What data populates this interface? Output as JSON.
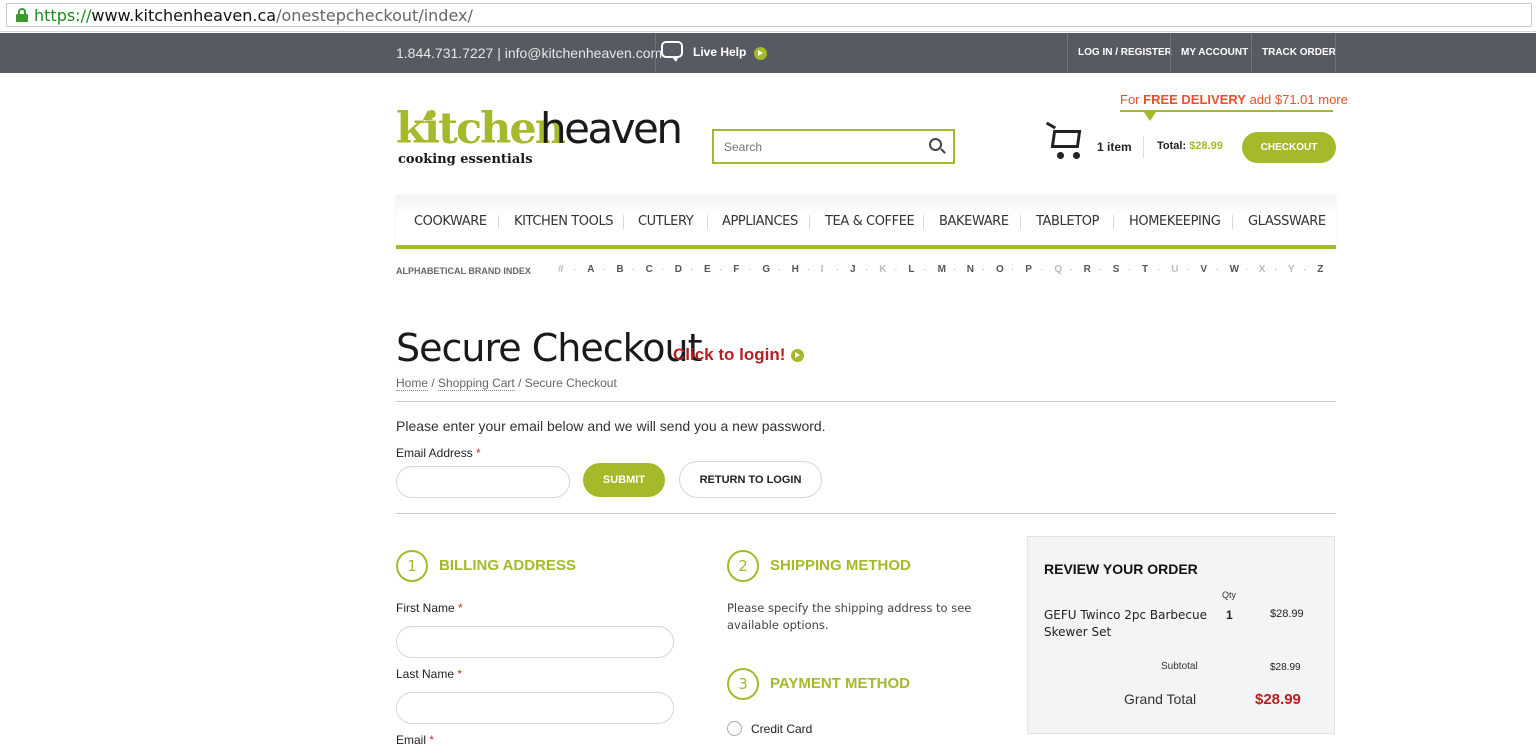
{
  "browser": {
    "url_protocol": "https://",
    "url_host": "www.kitchenheaven.ca",
    "url_path": "/onestepcheckout/index/"
  },
  "topbar": {
    "phone_email": "1.844.731.7227 | info@kitchenheaven.com",
    "live_help": "Live Help",
    "links": [
      "LOG IN / REGISTER",
      "MY ACCOUNT",
      "TRACK ORDER"
    ]
  },
  "header": {
    "logo_kitchen": "kitchen",
    "logo_heaven": "heaven",
    "logo_tagline": "cooking essentials",
    "search_placeholder": "Search",
    "delivery_for": "For ",
    "delivery_free": "FREE DELIVERY",
    "delivery_more": " add $71.01 more",
    "cart_count": "1 item",
    "cart_total_label": "Total: ",
    "cart_total_amount": "$28.99",
    "checkout_label": "CHECKOUT"
  },
  "nav": {
    "items": [
      "COOKWARE",
      "KITCHEN TOOLS",
      "CUTLERY",
      "APPLIANCES",
      "TEA & COFFEE",
      "BAKEWARE",
      "TABLETOP",
      "HOMEKEEPING",
      "GLASSWARE"
    ]
  },
  "brand_index": {
    "label": "ALPHABETICAL BRAND INDEX",
    "letters": [
      "#",
      "A",
      "B",
      "C",
      "D",
      "E",
      "F",
      "G",
      "H",
      "I",
      "J",
      "K",
      "L",
      "M",
      "N",
      "O",
      "P",
      "Q",
      "R",
      "S",
      "T",
      "U",
      "V",
      "W",
      "X",
      "Y",
      "Z"
    ],
    "disabled": [
      "#",
      "I",
      "K",
      "Q",
      "U",
      "X",
      "Y"
    ]
  },
  "page": {
    "title": "Secure Checkout",
    "login_link": "Click to login!",
    "breadcrumb_home": "Home",
    "breadcrumb_cart": "Shopping Cart",
    "breadcrumb_current": " / Secure Checkout",
    "forgot_text": "Please enter your email below and we will send you a new password.",
    "email_label": "Email Address",
    "submit_label": "SUBMIT",
    "return_label": "RETURN TO LOGIN"
  },
  "billing": {
    "step": "1",
    "title": "BILLING ADDRESS",
    "first_name_label": "First Name",
    "last_name_label": "Last Name",
    "email_label": "Email"
  },
  "shipping": {
    "step": "2",
    "title": "SHIPPING METHOD",
    "text": "Please specify the shipping address to see available options."
  },
  "payment": {
    "step": "3",
    "title": "PAYMENT METHOD",
    "option": "Credit Card"
  },
  "review": {
    "title": "REVIEW YOUR ORDER",
    "qty_header": "Qty",
    "item_name": "GEFU Twinco 2pc Barbecue Skewer Set",
    "item_qty": "1",
    "item_price": "$28.99",
    "subtotal_label": "Subtotal",
    "subtotal_value": "$28.99",
    "grand_total_label": "Grand Total",
    "grand_total_value": "$28.99"
  },
  "colors": {
    "accent_green": "#a6b92a",
    "topbar": "#565b63",
    "login_red": "#b51f24",
    "delivery_orange": "#e3522e"
  }
}
